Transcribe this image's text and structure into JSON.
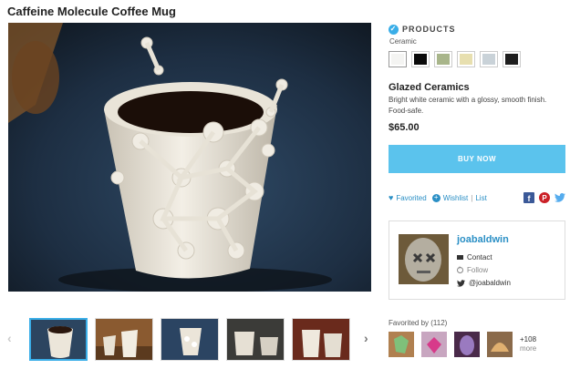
{
  "product": {
    "title": "Caffeine Molecule Coffee Mug"
  },
  "sidebar": {
    "products_label": "PRODUCTS",
    "material": "Ceramic",
    "swatches": [
      {
        "name": "white",
        "color": "#f4f4f2"
      },
      {
        "name": "black",
        "color": "#0a0a0a"
      },
      {
        "name": "sage",
        "color": "#a8b58a"
      },
      {
        "name": "cream",
        "color": "#e7dfaf"
      },
      {
        "name": "light-gray",
        "color": "#c9d2d8"
      },
      {
        "name": "charcoal",
        "color": "#1e1e1e"
      }
    ],
    "finish_name": "Glazed Ceramics",
    "finish_desc": "Bright white ceramic with a glossy, smooth finish. Food-safe.",
    "price": "$65.00",
    "buy_label": "BUY NOW",
    "favorited_label": "Favorited",
    "wishlist_label": "Wishlist",
    "list_label": "List",
    "separator": "|"
  },
  "profile": {
    "username": "joabaldwin",
    "contact_label": "Contact",
    "follow_label": "Follow",
    "twitter_handle": "@joabaldwin"
  },
  "favorites": {
    "title": "Favorited by (112)",
    "more_count": "+108",
    "more_label": "more"
  },
  "colors": {
    "accent": "#3aaee8",
    "buy_button": "#5bc3ed",
    "link": "#2a8fc5"
  },
  "icons": {
    "verified": "check-circle-icon",
    "favorite": "heart-icon",
    "wishlist": "plus-circle-icon",
    "facebook": "facebook-icon",
    "pinterest": "pinterest-icon",
    "twitter": "twitter-icon",
    "contact": "mail-icon",
    "follow": "follow-icon",
    "prev": "chevron-left-icon",
    "next": "chevron-right-icon"
  },
  "thumbnails": {
    "count": 5,
    "active_index": 0
  }
}
